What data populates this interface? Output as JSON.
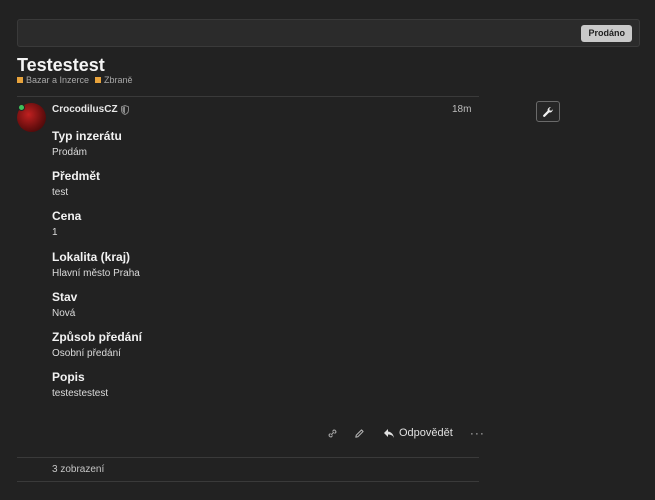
{
  "topbar": {
    "sold_label": "Prodáno"
  },
  "topic": {
    "title": "Testestest",
    "categories": [
      {
        "label": "Bazar a Inzerce",
        "color": "#e8a33c"
      },
      {
        "label": "Zbraně",
        "color": "#e8a33c"
      }
    ]
  },
  "post": {
    "username": "CrocodilusCZ",
    "time": "18m",
    "fields": [
      {
        "label": "Typ inzerátu",
        "value": "Prodám"
      },
      {
        "label": "Předmět",
        "value": "test"
      },
      {
        "label": "Cena",
        "value": "1"
      },
      {
        "label": "Lokalita (kraj)",
        "value": "Hlavní město Praha"
      },
      {
        "label": "Stav",
        "value": "Nová"
      },
      {
        "label": "Způsob předání",
        "value": "Osobní předání"
      },
      {
        "label": "Popis",
        "value": "testestestest"
      }
    ],
    "actions": {
      "reply_label": "Odpovědět",
      "more_label": "···"
    }
  },
  "footer": {
    "views": "3 zobrazení"
  },
  "icons": [
    "shield-icon",
    "wrench-icon",
    "link-icon",
    "pencil-icon",
    "reply-icon",
    "more-icon"
  ],
  "colors": {
    "background": "#222222",
    "category": "#e8a33c",
    "online": "#3fbf5a"
  }
}
